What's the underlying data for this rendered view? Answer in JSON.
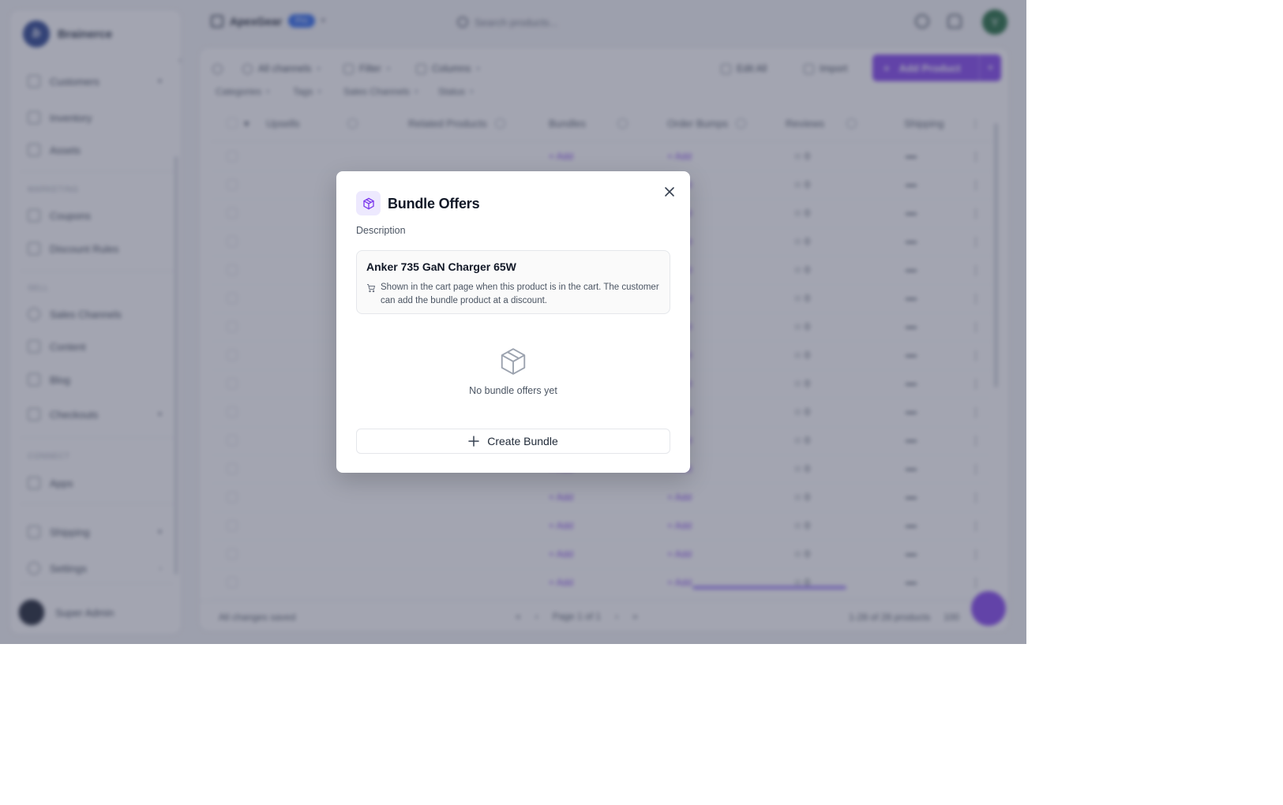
{
  "sidebar": {
    "brand": "Brainerce",
    "items": [
      {
        "label": "Customers"
      },
      {
        "label": "Inventory"
      },
      {
        "label": "Assets"
      },
      {
        "label": "Coupons"
      },
      {
        "label": "Discount Rules"
      },
      {
        "label": "Sales Channels"
      },
      {
        "label": "Content"
      },
      {
        "label": "Blog"
      },
      {
        "label": "Checkouts"
      },
      {
        "label": "Apps"
      },
      {
        "label": "Shipping"
      },
      {
        "label": "Settings"
      }
    ],
    "sections": [
      "Marketing",
      "Sell",
      "Connect"
    ],
    "user_name": "Super Admin"
  },
  "header": {
    "store_name": "ApexGear",
    "plan_badge": "Pro",
    "search_placeholder": "Search products...",
    "avatar_initial": "Y"
  },
  "toolbar": {
    "channels": "All channels",
    "filter": "Filter",
    "columns": "Columns",
    "edit_all": "Edit All",
    "import": "Import",
    "add_product": "Add Product"
  },
  "filters": [
    "Categories",
    "Tags",
    "Sales Channels",
    "Status"
  ],
  "table": {
    "columns": [
      "Upsells",
      "Related Products",
      "Bundles",
      "Order Bumps",
      "Reviews",
      "Shipping"
    ],
    "add_label": "+ Add",
    "review_value": "☆ 0"
  },
  "footer": {
    "saved": "All changes saved",
    "page": "Page 1 of 1",
    "count": "1-28 of 28 products",
    "per_page": "100"
  },
  "modal": {
    "title": "Bundle Offers",
    "description_label": "Description",
    "product_name": "Anker 735 GaN Charger 65W",
    "product_description": "Shown in the cart page when this product is in the cart. The customer can add the bundle product at a discount.",
    "empty_text": "No bundle offers yet",
    "create_button": "Create Bundle"
  },
  "colors": {
    "accent": "#7c3aed",
    "accent_soft": "#ede9fe",
    "badge": "#2563eb"
  }
}
